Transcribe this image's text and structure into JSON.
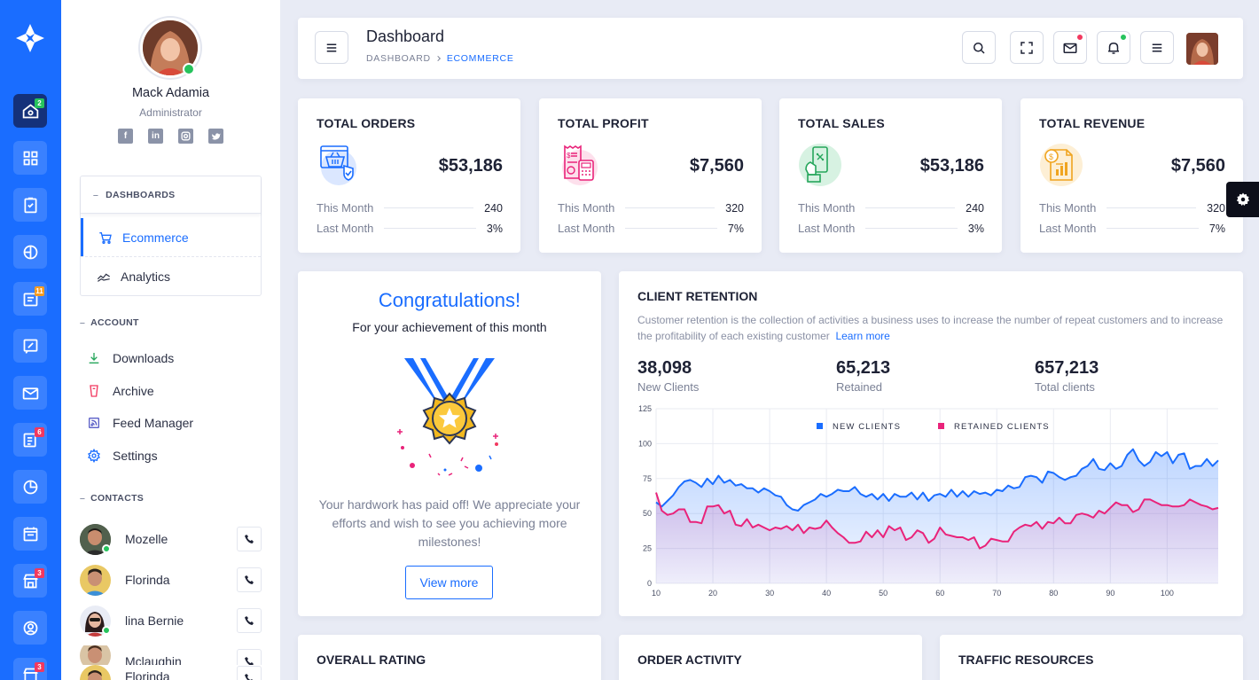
{
  "rail": {
    "badges": {
      "home": "2",
      "invoice": "11",
      "reports": "6",
      "store": "3",
      "last": "3"
    },
    "colors": {
      "bg": "#1a6dff",
      "active": "#14317a",
      "badge_green": "#26c35c",
      "badge_orange": "#f79b1f",
      "badge_red": "#f2385f"
    }
  },
  "profile": {
    "name": "Mack Adamia",
    "role": "Administrator",
    "socials": [
      "facebook-icon",
      "linkedin-icon",
      "instagram-icon",
      "twitter-icon"
    ]
  },
  "sidebar": {
    "dashboards_header": "DASHBOARDS",
    "dashboards": [
      {
        "label": "Ecommerce",
        "icon": "cart-icon",
        "active": true
      },
      {
        "label": "Analytics",
        "icon": "chart-icon",
        "active": false
      }
    ],
    "account_title": "ACCOUNT",
    "account": [
      {
        "label": "Downloads",
        "icon": "download-icon"
      },
      {
        "label": "Archive",
        "icon": "archive-icon"
      },
      {
        "label": "Feed Manager",
        "icon": "rss-icon"
      },
      {
        "label": "Settings",
        "icon": "gear-icon"
      }
    ],
    "contacts_title": "CONTACTS",
    "contacts": [
      {
        "name": "Mozelle"
      },
      {
        "name": "Florinda"
      },
      {
        "name": "lina Bernie"
      },
      {
        "name": "Mclaughin"
      },
      {
        "name": "Florinda"
      }
    ]
  },
  "topbar": {
    "title": "Dashboard",
    "crumb_root": "DASHBOARD",
    "crumb_current": "ECOMMERCE"
  },
  "stats": [
    {
      "title": "TOTAL ORDERS",
      "value": "$53,186",
      "this_month_label": "This Month",
      "this_month": "240",
      "last_month_label": "Last Month",
      "last_month": "3%",
      "icon": "basket-icon",
      "color": "#1a6dff"
    },
    {
      "title": "TOTAL PROFIT",
      "value": "$7,560",
      "this_month_label": "This Month",
      "this_month": "320",
      "last_month_label": "Last Month",
      "last_month": "7%",
      "icon": "receipt-icon",
      "color": "#e9237a"
    },
    {
      "title": "TOTAL SALES",
      "value": "$53,186",
      "this_month_label": "This Month",
      "this_month": "240",
      "last_month_label": "Last Month",
      "last_month": "3%",
      "icon": "phone-sale-icon",
      "color": "#26a65b"
    },
    {
      "title": "TOTAL REVENUE",
      "value": "$7,560",
      "this_month_label": "This Month",
      "this_month": "320",
      "last_month_label": "Last Month",
      "last_month": "7%",
      "icon": "revenue-doc-icon",
      "color": "#f0a41f"
    }
  ],
  "congrats": {
    "title": "Congratulations!",
    "subtitle": "For your achievement of this month",
    "text": "Your hardwork has paid off! We appreciate your efforts and wish to see you achieving more milestones!",
    "button": "View more"
  },
  "retention": {
    "title": "CLIENT RETENTION",
    "description": "Customer retention is the collection of activities a business uses to increase the number of repeat customers and to increase the profitability of each existing customer",
    "learn_more": "Learn more",
    "stats": [
      {
        "value": "38,098",
        "label": "New Clients"
      },
      {
        "value": "65,213",
        "label": "Retained"
      },
      {
        "value": "657,213",
        "label": "Total clients"
      }
    ]
  },
  "chart_data": {
    "type": "area",
    "title": "",
    "xlabel": "",
    "ylabel": "",
    "xlim": [
      10,
      109
    ],
    "ylim": [
      0,
      125
    ],
    "xticks": [
      10,
      20,
      30,
      40,
      50,
      60,
      70,
      80,
      90,
      100
    ],
    "yticks": [
      0,
      25,
      50,
      75,
      100,
      125
    ],
    "grid": true,
    "legend_position": "top-center",
    "x": [
      10,
      11,
      12,
      13,
      14,
      15,
      16,
      17,
      18,
      19,
      20,
      21,
      22,
      23,
      24,
      25,
      26,
      27,
      28,
      29,
      30,
      31,
      32,
      33,
      34,
      35,
      36,
      37,
      38,
      39,
      40,
      41,
      42,
      43,
      44,
      45,
      46,
      47,
      48,
      49,
      50,
      51,
      52,
      53,
      54,
      55,
      56,
      57,
      58,
      59,
      60,
      61,
      62,
      63,
      64,
      65,
      66,
      67,
      68,
      69,
      70,
      71,
      72,
      73,
      74,
      75,
      76,
      77,
      78,
      79,
      80,
      81,
      82,
      83,
      84,
      85,
      86,
      87,
      88,
      89,
      90,
      91,
      92,
      93,
      94,
      95,
      96,
      97,
      98,
      99,
      100,
      101,
      102,
      103,
      104,
      105,
      106,
      107,
      108,
      109
    ],
    "series": [
      {
        "name": "NEW CLIENTS",
        "color": "#1a6dff",
        "values": [
          58,
          55,
          59,
          63,
          69,
          73,
          74,
          72,
          69,
          75,
          71,
          77,
          72,
          74,
          70,
          71,
          68,
          68,
          65,
          68,
          66,
          63,
          62,
          56,
          53,
          52,
          56,
          58,
          60,
          64,
          62,
          64,
          67,
          66,
          66,
          69,
          64,
          62,
          64,
          60,
          64,
          59,
          64,
          62,
          62,
          65,
          60,
          65,
          59,
          63,
          64,
          62,
          67,
          62,
          66,
          62,
          66,
          64,
          65,
          63,
          67,
          66,
          70,
          68,
          69,
          76,
          77,
          76,
          72,
          80,
          79,
          76,
          74,
          76,
          77,
          82,
          84,
          89,
          82,
          81,
          86,
          82,
          84,
          92,
          96,
          88,
          84,
          87,
          94,
          91,
          94,
          86,
          92,
          93,
          82,
          84,
          84,
          89,
          84,
          88
        ]
      },
      {
        "name": "RETAINED CLIENTS",
        "color": "#e9237a",
        "values": [
          65,
          52,
          49,
          50,
          53,
          53,
          44,
          44,
          43,
          55,
          55,
          56,
          50,
          52,
          42,
          41,
          46,
          40,
          42,
          40,
          38,
          40,
          39,
          41,
          38,
          42,
          36,
          40,
          39,
          40,
          45,
          40,
          36,
          33,
          29,
          29,
          30,
          37,
          33,
          38,
          33,
          41,
          38,
          40,
          31,
          33,
          38,
          36,
          29,
          32,
          40,
          35,
          34,
          33,
          33,
          31,
          33,
          25,
          27,
          32,
          31,
          30,
          30,
          37,
          40,
          42,
          41,
          44,
          39,
          44,
          43,
          47,
          43,
          43,
          49,
          50,
          49,
          47,
          52,
          50,
          54,
          58,
          56,
          56,
          51,
          53,
          60,
          60,
          58,
          56,
          56,
          55,
          55,
          56,
          60,
          58,
          56,
          55,
          53,
          54
        ]
      }
    ]
  },
  "bottom_cards": [
    "OVERALL RATING",
    "ORDER ACTIVITY",
    "TRAFFIC RESOURCES"
  ]
}
